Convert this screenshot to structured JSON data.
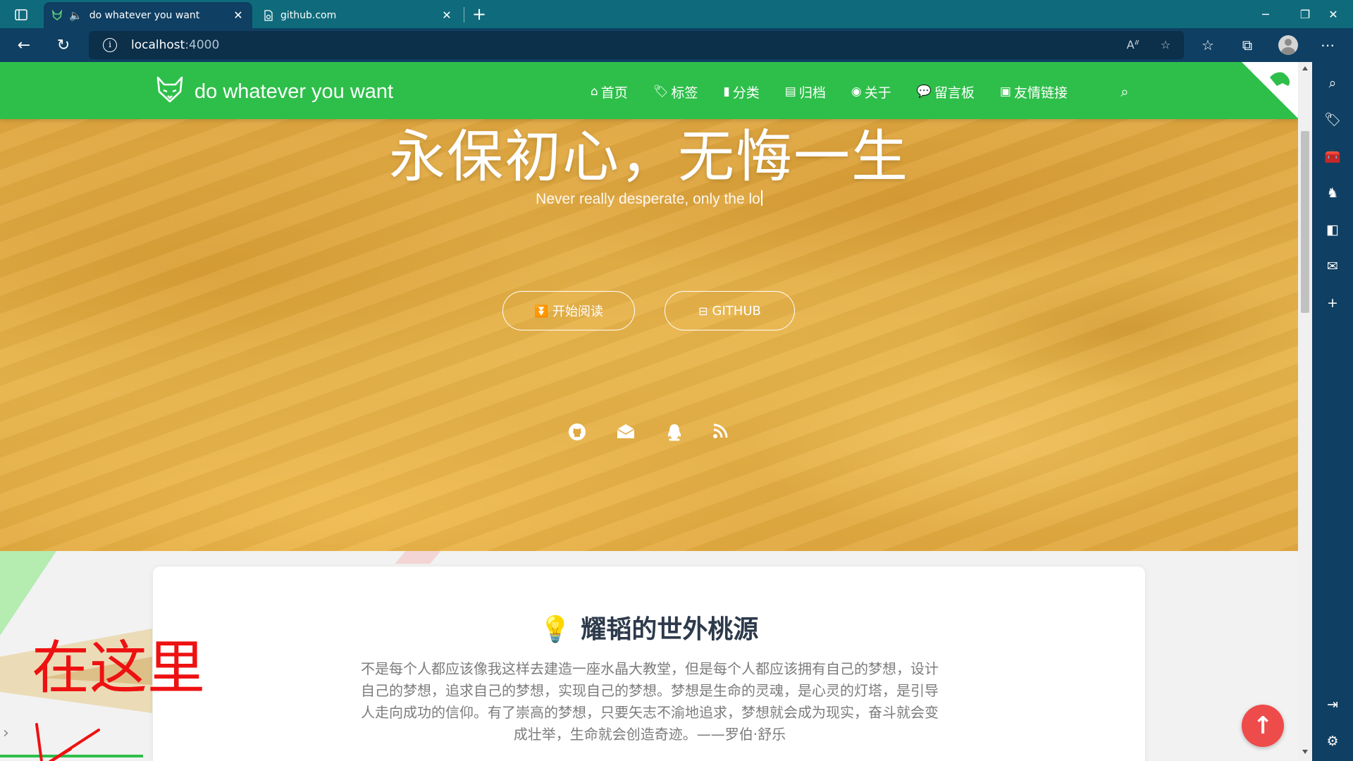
{
  "browser": {
    "tabs": [
      {
        "title": "do whatever you want",
        "favicon": "fox-logo-icon",
        "audio": true,
        "active": true
      },
      {
        "title": "github.com",
        "favicon": "page-sync-icon",
        "active": false
      }
    ],
    "address": {
      "host": "localhost",
      "port": ":4000"
    },
    "colors": {
      "tabbar": "#0f6b7c",
      "toolbar": "#0f3f62"
    }
  },
  "site": {
    "title": "do whatever you want",
    "menu": [
      {
        "label": "首页",
        "icon": "home-icon"
      },
      {
        "label": "标签",
        "icon": "tags-icon"
      },
      {
        "label": "分类",
        "icon": "bookmark-icon"
      },
      {
        "label": "归档",
        "icon": "archive-icon"
      },
      {
        "label": "关于",
        "icon": "user-circle-icon"
      },
      {
        "label": "留言板",
        "icon": "comments-icon"
      },
      {
        "label": "友情链接",
        "icon": "address-book-icon"
      }
    ],
    "header_color": "#2ebf4a"
  },
  "hero": {
    "title": "永保初心，无悔一生",
    "subtitle": "Never really desperate, only the lo",
    "buttons": [
      {
        "label": "开始阅读",
        "icon": "angle-double-down-icon"
      },
      {
        "label": "GITHUB",
        "icon": "github-alt-icon"
      }
    ],
    "social": [
      "github-icon",
      "email-icon",
      "qq-icon",
      "rss-icon"
    ]
  },
  "card": {
    "title": "耀韬的世外桃源",
    "text": "不是每个人都应该像我这样去建造一座水晶大教堂，但是每个人都应该拥有自己的梦想，设计自己的梦想，追求自己的梦想，实现自己的梦想。梦想是生命的灵魂，是心灵的灯塔，是引导人走向成功的信仰。有了崇高的梦想，只要矢志不渝地追求，梦想就会成为现实，奋斗就会变成壮举，生命就会创造奇迹。——罗伯·舒乐"
  },
  "annotation": {
    "text": "在这里"
  }
}
